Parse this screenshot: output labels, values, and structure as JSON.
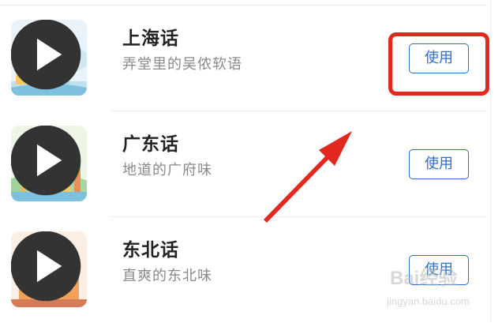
{
  "dialects": [
    {
      "name": "上海话",
      "desc": "弄堂里的吴侬软语",
      "button": "使用",
      "thumbnail_icon": "shanghai-skyline-icon"
    },
    {
      "name": "广东话",
      "desc": "地道的广府味",
      "button": "使用",
      "thumbnail_icon": "guangzhou-skyline-icon"
    },
    {
      "name": "东北话",
      "desc": "直爽的东北味",
      "button": "使用",
      "thumbnail_icon": "harbin-church-icon"
    }
  ],
  "annotation": {
    "highlight_color": "#e3281f",
    "arrow_color": "#e3281f"
  },
  "watermark": {
    "brand": "Bai经验",
    "url": "jingyan.baidu.com"
  },
  "colors": {
    "accent": "#2b6fcf",
    "title": "#222222",
    "subtitle": "#8a8a8a"
  }
}
